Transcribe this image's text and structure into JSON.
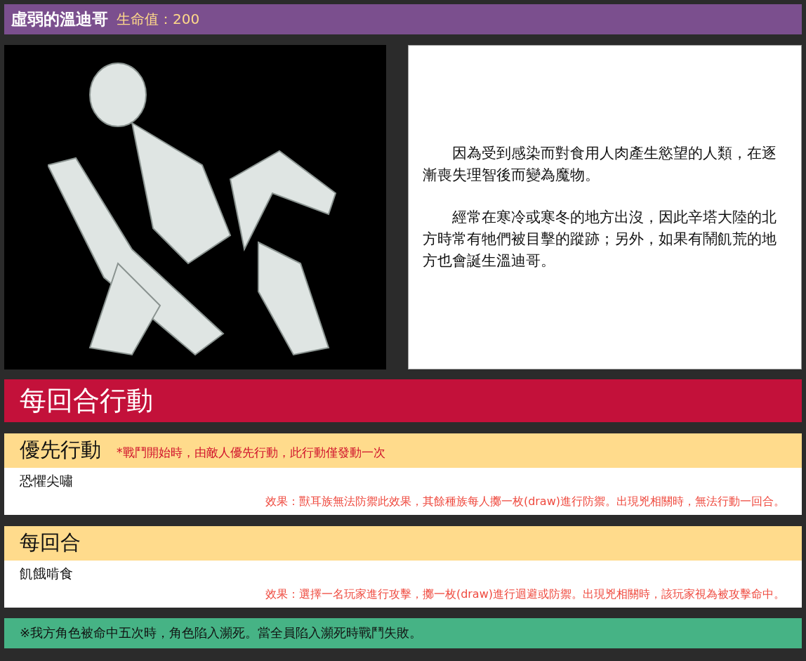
{
  "header": {
    "name": "虛弱的溫迪哥",
    "hp_label": "生命值：200"
  },
  "description": {
    "paragraphs": [
      "因為受到感染而對食用人肉產生慾望的人類，在逐漸喪失理智後而變為魔物。",
      "經常在寒冷或寒冬的地方出沒，因此辛塔大陸的北方時常有牠們被目擊的蹤跡；另外，如果有鬧飢荒的地方也會誕生溫迪哥。"
    ]
  },
  "section_title": "每回合行動",
  "actions": [
    {
      "title": "優先行動",
      "note": "*戰鬥開始時，由敵人優先行動，此行動僅發動一次",
      "name": "恐懼尖嘯",
      "effect": "效果：獸耳族無法防禦此效果，其餘種族每人擲一枚(draw)進行防禦。出現兇相關時，無法行動一回合。"
    },
    {
      "title": "每回合",
      "name": "飢餓啃食",
      "effect": "效果：選擇一名玩家進行攻擊，擲一枚(draw)進行迴避或防禦。出現兇相關時，該玩家視為被攻擊命中。"
    }
  ],
  "footer": "※我方角色被命中五次時，角色陷入瀕死。當全員陷入瀕死時戰鬥失敗。"
}
